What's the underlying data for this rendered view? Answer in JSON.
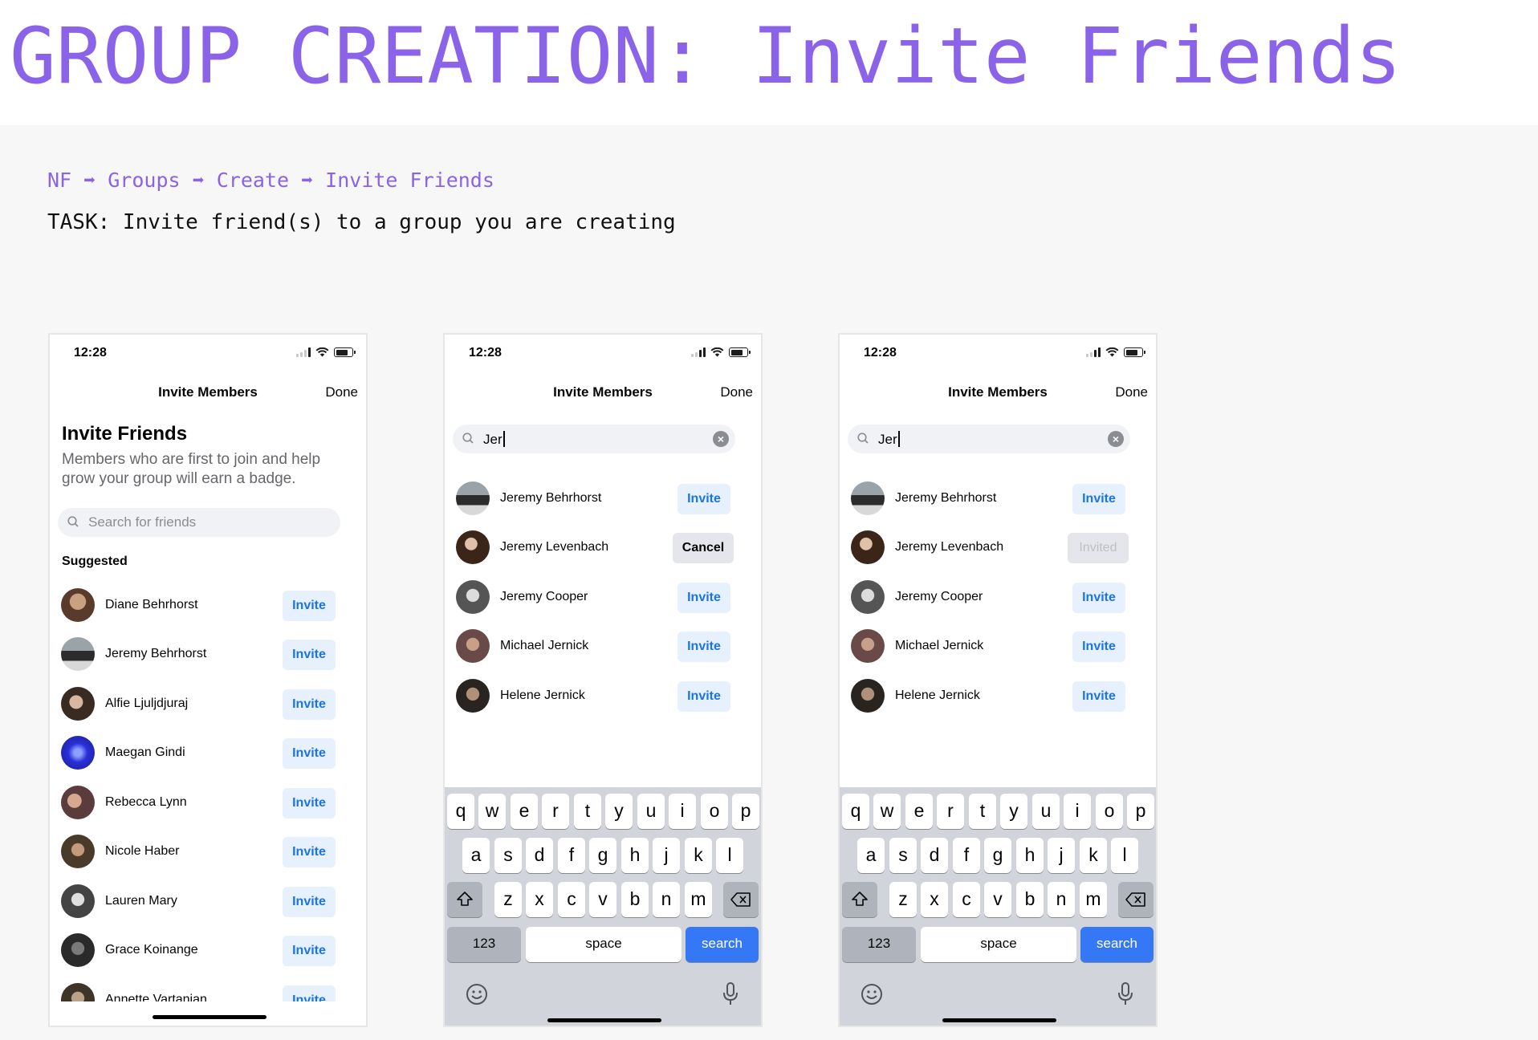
{
  "header": {
    "title": "GROUP CREATION: Invite Friends",
    "breadcrumb": "NF ➡ Groups ➡ Create ➡ Invite Friends",
    "task": "TASK: Invite friend(s) to a group you are creating"
  },
  "screens": [
    {
      "status_time": "12:28",
      "nav_title": "Invite Members",
      "nav_done": "Done",
      "heading": "Invite Friends",
      "subtext": "Members who are first to join and help grow your group will earn a badge.",
      "search_placeholder": "Search for friends",
      "section_label": "Suggested",
      "rows": [
        {
          "name": "Diane Behrhorst",
          "button": "Invite"
        },
        {
          "name": "Jeremy Behrhorst",
          "button": "Invite"
        },
        {
          "name": "Alfie Ljuljdjuraj",
          "button": "Invite"
        },
        {
          "name": "Maegan Gindi",
          "button": "Invite"
        },
        {
          "name": "Rebecca Lynn",
          "button": "Invite"
        },
        {
          "name": "Nicole Haber",
          "button": "Invite"
        },
        {
          "name": "Lauren Mary",
          "button": "Invite"
        },
        {
          "name": "Grace Koinange",
          "button": "Invite"
        },
        {
          "name": "Annette Vartanian",
          "button": "Invite"
        }
      ]
    },
    {
      "status_time": "12:28",
      "nav_title": "Invite Members",
      "nav_done": "Done",
      "search_value": "Jer",
      "rows": [
        {
          "name": "Jeremy Behrhorst",
          "button": "Invite"
        },
        {
          "name": "Jeremy Levenbach",
          "button": "Cancel"
        },
        {
          "name": "Jeremy Cooper",
          "button": "Invite"
        },
        {
          "name": "Michael Jernick",
          "button": "Invite"
        },
        {
          "name": "Helene Jernick",
          "button": "Invite"
        }
      ]
    },
    {
      "status_time": "12:28",
      "nav_title": "Invite Members",
      "nav_done": "Done",
      "search_value": "Jer",
      "rows": [
        {
          "name": "Jeremy Behrhorst",
          "button": "Invite"
        },
        {
          "name": "Jeremy Levenbach",
          "button": "Invited"
        },
        {
          "name": "Jeremy Cooper",
          "button": "Invite"
        },
        {
          "name": "Michael Jernick",
          "button": "Invite"
        },
        {
          "name": "Helene Jernick",
          "button": "Invite"
        }
      ]
    }
  ],
  "keyboard": {
    "row1": [
      "q",
      "w",
      "e",
      "r",
      "t",
      "y",
      "u",
      "i",
      "o",
      "p"
    ],
    "row2": [
      "a",
      "s",
      "d",
      "f",
      "g",
      "h",
      "j",
      "k",
      "l"
    ],
    "row3": [
      "z",
      "x",
      "c",
      "v",
      "b",
      "n",
      "m"
    ],
    "numbers_key": "123",
    "space_key": "space",
    "search_key": "search"
  },
  "colors": {
    "title_purple": "#8b63e8",
    "invite_blue": "#1b74e4",
    "invite_bg": "#e7f0fd",
    "keyboard_search": "#3478f6"
  }
}
